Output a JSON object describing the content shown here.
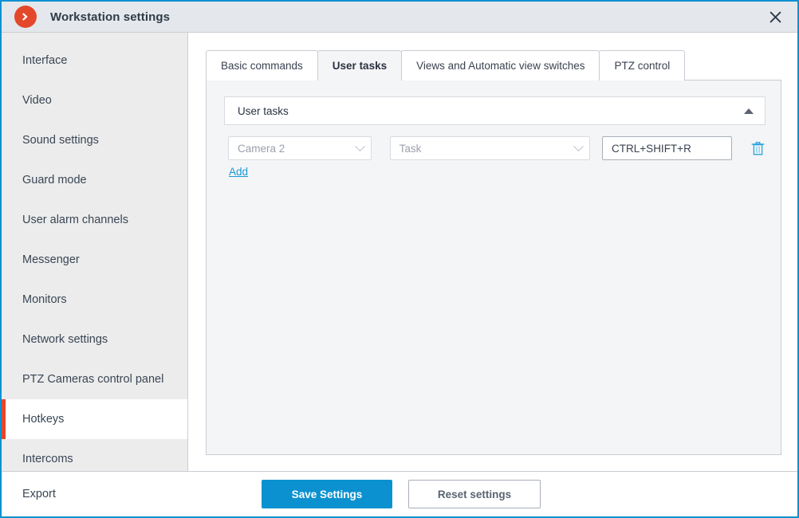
{
  "window": {
    "title": "Workstation settings",
    "logo_icon": "orange-chevron-right-logo",
    "close_icon": "close-icon",
    "accent_color": "#0c91d0",
    "brand_color": "#e4482a"
  },
  "sidebar": {
    "items": [
      {
        "label": "Interface",
        "active": false
      },
      {
        "label": "Video",
        "active": false
      },
      {
        "label": "Sound settings",
        "active": false
      },
      {
        "label": "Guard mode",
        "active": false
      },
      {
        "label": "User alarm channels",
        "active": false
      },
      {
        "label": "Messenger",
        "active": false
      },
      {
        "label": "Monitors",
        "active": false
      },
      {
        "label": "Network settings",
        "active": false
      },
      {
        "label": "PTZ Cameras control panel",
        "active": false
      },
      {
        "label": "Hotkeys",
        "active": true
      },
      {
        "label": "Intercoms",
        "active": false
      }
    ]
  },
  "main": {
    "tabs": [
      {
        "label": "Basic commands",
        "active": false
      },
      {
        "label": "User tasks",
        "active": true
      },
      {
        "label": "Views and Automatic view switches",
        "active": false
      },
      {
        "label": "PTZ control",
        "active": false
      }
    ],
    "group": {
      "title": "User tasks",
      "collapse_icon": "caret-up-icon",
      "expanded": true
    },
    "rows": [
      {
        "camera": {
          "value": "Camera 2",
          "placeholder": "Camera 2",
          "icon": "chevron-down-icon"
        },
        "task": {
          "value": "",
          "placeholder": "Task",
          "icon": "chevron-down-icon"
        },
        "hotkey": {
          "value": "CTRL+SHIFT+R",
          "placeholder": ""
        },
        "delete_icon": "trash-icon"
      }
    ],
    "add_label": "Add"
  },
  "footer": {
    "export_label": "Export",
    "save_label": "Save Settings",
    "reset_label": "Reset settings"
  }
}
